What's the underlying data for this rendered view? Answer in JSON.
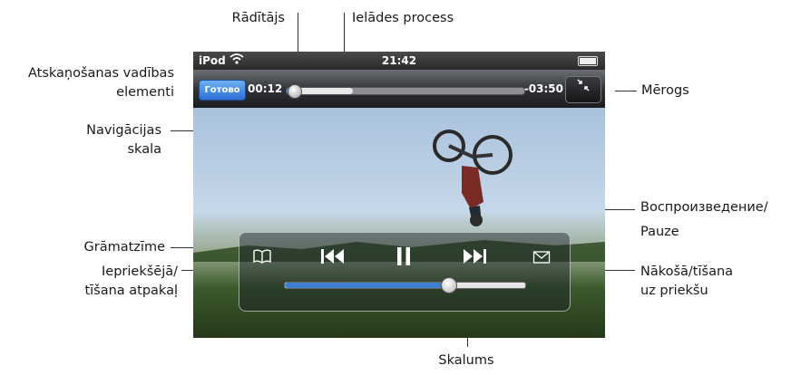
{
  "labels": {
    "playhead": "Rādītājs",
    "download_progress": "Ielādes process",
    "playback_controls_l1": "Atskaņošanas vadības",
    "playback_controls_l2": "elementi",
    "scale": "Mērogs",
    "scrubber_l1": "Navigācijas",
    "scrubber_l2": "skala",
    "bookmark": "Grāmatzīme",
    "previous_l1": "Iepriekšējā/",
    "previous_l2": "tīšana atpakaļ",
    "playpause_l1": "Воспроизведение/",
    "playpause_l2": "Pauze",
    "next_l1": "Nākošā/tīšana",
    "next_l2": "uz priekšu",
    "volume": "Skalums"
  },
  "status_bar": {
    "carrier": "iPod",
    "time": "21:42"
  },
  "top_bar": {
    "done_label": "Готово",
    "elapsed": "00:12",
    "remaining": "-03:50"
  },
  "scrubber": {
    "played_fraction": 0.03,
    "loaded_fraction": 0.28
  },
  "volume": {
    "level_fraction": 0.68
  },
  "icons": {
    "wifi": "wifi-icon",
    "battery": "battery-icon",
    "scale": "scale-icon",
    "bookmark": "bookmark-icon",
    "previous": "previous-icon",
    "pause": "pause-icon",
    "next": "next-icon",
    "email": "email-icon"
  }
}
